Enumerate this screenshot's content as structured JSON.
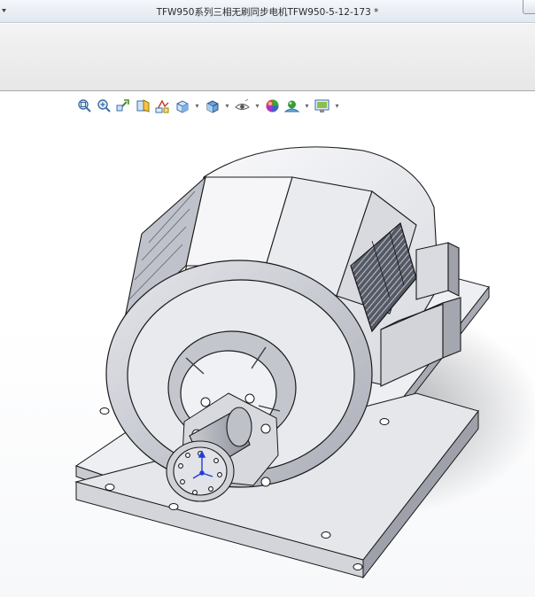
{
  "window": {
    "title": "TFW950系列三相无刷同步电机TFW950-5-12-173 *"
  },
  "ribbon": {},
  "view_toolbar": {
    "buttons": [
      {
        "name": "zoom-to-fit-icon"
      },
      {
        "name": "zoom-to-area-icon"
      },
      {
        "name": "previous-view-icon"
      },
      {
        "name": "section-view-icon"
      },
      {
        "name": "dynamic-annotation-views-icon"
      },
      {
        "name": "view-orientation-icon",
        "dropdown": true
      },
      {
        "name": "display-style-icon",
        "dropdown": true
      },
      {
        "name": "hide-show-items-icon",
        "dropdown": true
      },
      {
        "name": "edit-appearance-icon"
      },
      {
        "name": "apply-scene-icon",
        "dropdown": true
      },
      {
        "name": "view-settings-icon",
        "dropdown": true
      }
    ]
  },
  "colors": {
    "titlebar": "#e8edf3",
    "ribbon": "#ececec",
    "viewport_bg": "#ffffff",
    "model_face_light": "#f4f4f6",
    "model_face_mid": "#dcdde2",
    "model_face_dark": "#b9bbc3",
    "model_edge": "#1a1a1a",
    "triad_blue": "#1f3fd6"
  }
}
